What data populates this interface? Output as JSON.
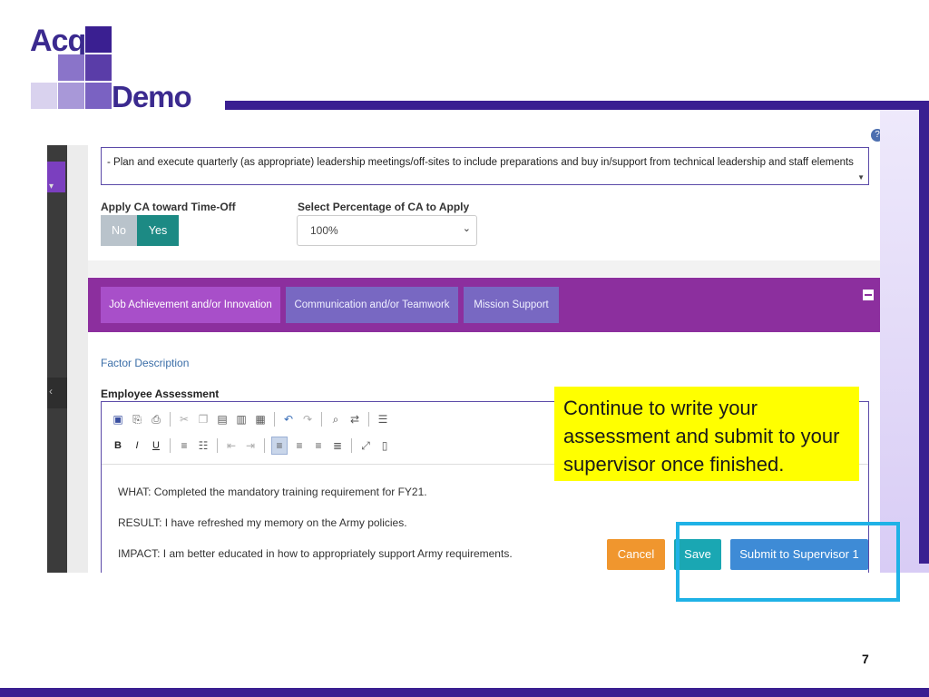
{
  "logo": {
    "acq": "Acq",
    "demo": "Demo"
  },
  "slide": {
    "page_number": "7"
  },
  "colors": {
    "brand_purple": "#3a1f91",
    "panel_purple": "#8c2f9e",
    "callout_yellow": "#ffff00",
    "highlight_cyan": "#1fb2e6"
  },
  "form": {
    "objective_text": "- Plan and execute quarterly (as appropriate) leadership meetings/off-sites to include preparations and buy in/support from technical leadership and staff elements",
    "apply_ca_label": "Apply CA toward Time-Off",
    "toggle_no": "No",
    "toggle_yes": "Yes",
    "select_label": "Select Percentage of CA to Apply",
    "select_value": "100%",
    "help_icon": "?"
  },
  "tabs": [
    {
      "label": "Job Achievement and/or Innovation",
      "active": true
    },
    {
      "label": "Communication and/or Teamwork",
      "active": false
    },
    {
      "label": "Mission Support",
      "active": false
    }
  ],
  "factor_description": "Factor Description",
  "employee_assessment": {
    "label": "Employee Assessment",
    "toolbar_bold": "B",
    "toolbar_italic": "I",
    "toolbar_underline": "U",
    "lines": [
      "WHAT: Completed the mandatory training requirement for FY21.",
      "RESULT: I have refreshed my memory on the Army policies.",
      "IMPACT: I am better educated in how to appropriately support Army requirements."
    ]
  },
  "buttons": {
    "cancel": "Cancel",
    "save": "Save",
    "submit": "Submit to Supervisor 1"
  },
  "callout": {
    "text": "Continue to write your assessment and submit to your supervisor once finished."
  }
}
